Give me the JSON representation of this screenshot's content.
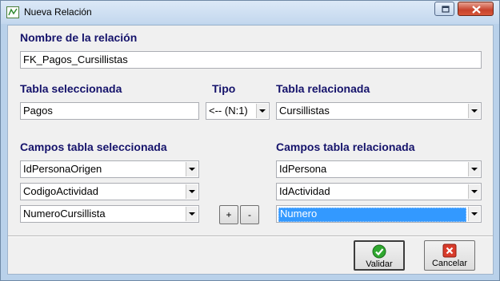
{
  "window": {
    "title": "Nueva Relación"
  },
  "form": {
    "relation_name_label": "Nombre de la relación",
    "relation_name_value": "FK_Pagos_Cursillistas",
    "selected_table_label": "Tabla seleccionada",
    "selected_table_value": "Pagos",
    "type_label": "Tipo",
    "type_value": "<-- (N:1)",
    "related_table_label": "Tabla relacionada",
    "related_table_value": "Cursillistas",
    "selected_fields_label": "Campos tabla seleccionada",
    "related_fields_label": "Campos tabla relacionada",
    "selected_fields": [
      "IdPersonaOrigen",
      "CodigoActividad",
      "NumeroCursillista"
    ],
    "related_fields": [
      "IdPersona",
      "IdActividad",
      "Numero"
    ],
    "add_label": "+",
    "remove_label": "-"
  },
  "buttons": {
    "validate_label": "Validar",
    "cancel_label": "Cancelar"
  },
  "icons": {
    "validate": "green-check-icon",
    "cancel": "red-x-icon",
    "app": "relation-icon"
  }
}
